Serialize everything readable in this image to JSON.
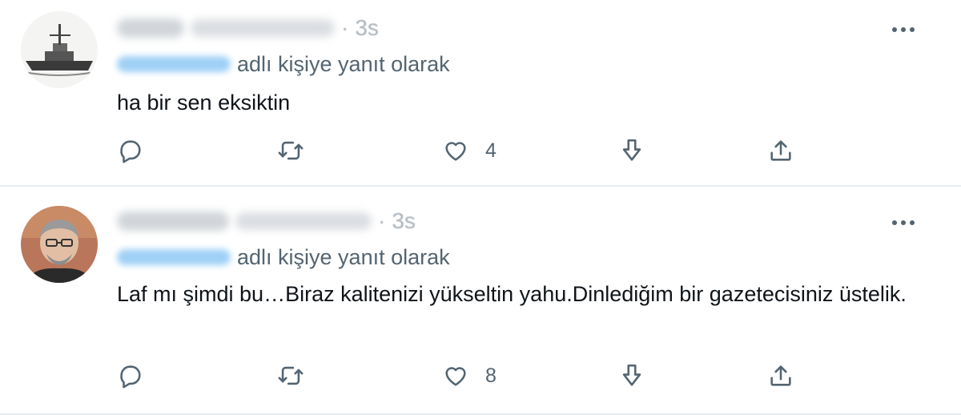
{
  "tweets": [
    {
      "time": "3s",
      "reply_suffix": "adlı kişiye yanıt olarak",
      "text": "ha bir sen eksiktin",
      "likes": "4",
      "avatar_icon": "ship-icon"
    },
    {
      "time": "3s",
      "reply_suffix": "adlı kişiye yanıt olarak",
      "text": "Laf mı şimdi bu…Biraz kalitenizi yükseltin yahu.Dinlediğim bir gazetecisiniz üstelik.",
      "likes": "8",
      "avatar_icon": "person-icon"
    }
  ],
  "icons": {
    "reply": "reply-icon",
    "retweet": "retweet-icon",
    "like": "heart-icon",
    "downvote": "down-arrow-icon",
    "share": "share-icon",
    "more": "more-options-icon"
  },
  "colors": {
    "text": "#0f1419",
    "secondary": "#536471",
    "mention": "#1d9bf0",
    "divider": "#e6ecf0"
  }
}
